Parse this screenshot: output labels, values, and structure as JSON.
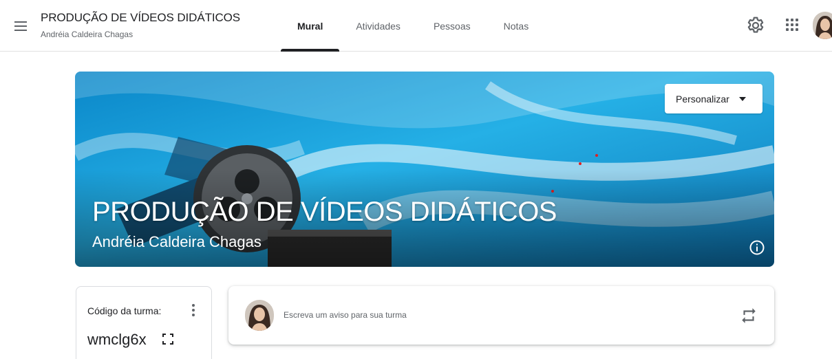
{
  "header": {
    "class_title": "PRODUÇÃO DE VÍDEOS DIDÁTICOS",
    "teacher_name": "Andréia Caldeira Chagas",
    "tabs": [
      {
        "label": "Mural",
        "active": true
      },
      {
        "label": "Atividades",
        "active": false
      },
      {
        "label": "Pessoas",
        "active": false
      },
      {
        "label": "Notas",
        "active": false
      }
    ],
    "icons": {
      "menu": "hamburger-menu-icon",
      "settings": "gear-icon",
      "apps": "apps-grid-icon",
      "profile": "avatar"
    }
  },
  "banner": {
    "title": "PRODUÇÃO DE VÍDEOS DIDÁTICOS",
    "subtitle": "Andréia Caldeira Chagas",
    "customize_label": "Personalizar",
    "theme_colors": {
      "sky": "#1aa3dc",
      "deep": "#0b6fae",
      "reel": "#3c4043"
    }
  },
  "class_code": {
    "label": "Código da turma:",
    "value": "wmclg6x"
  },
  "announcement": {
    "placeholder": "Escreva um aviso para sua turma"
  },
  "colors": {
    "text_primary": "#202124",
    "text_secondary": "#5f6368",
    "divider": "#e0e0e0"
  }
}
